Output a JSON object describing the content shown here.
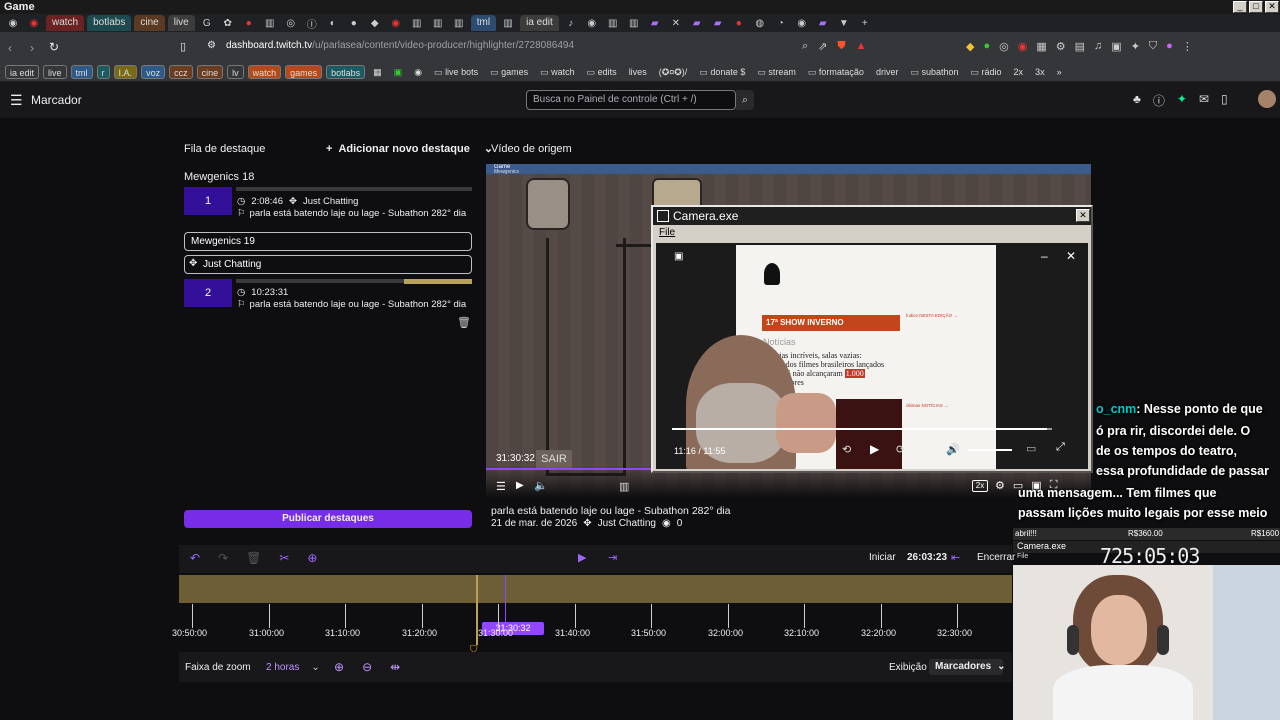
{
  "window": {
    "title": "Game"
  },
  "browser": {
    "tabs": [
      "watch",
      "botlabs",
      "cine",
      "live",
      "tml",
      "ia edit"
    ],
    "url": "dashboard.twitch.tv/u/parlasea/content/video-producer/highlighter/2728086494",
    "url_host": "dashboard.twitch.tv",
    "url_path": "/u/parlasea/content/video-producer/highlighter/2728086494",
    "bookmarks": [
      "ia edit",
      "live",
      "tml",
      "r",
      "I.A.",
      "voz",
      "ccz",
      "cine",
      "lv",
      "watch",
      "games",
      "botlabs",
      "live bots",
      "games",
      "watch",
      "edits",
      "lives",
      "(✪¤✪)/",
      "donate $",
      "stream",
      "formatação",
      "driver",
      "subathon",
      "rádio",
      "2x",
      "3x"
    ]
  },
  "header": {
    "title": "Marcador",
    "search_placeholder": "Busca no Painel de controle (Ctrl + /)"
  },
  "queue": {
    "title": "Fila de destaque",
    "add_label": "Adicionar novo destaque",
    "groups": [
      {
        "name": "Mewgenics 18",
        "number": "1",
        "time": "2:08:46",
        "category": "Just Chatting",
        "title": "parla está batendo laje ou lage - Subathon 282° dia"
      },
      {
        "name": "Mewgenics 19",
        "number": "2",
        "category": "Just Chatting",
        "time": "10:23:31",
        "title": "parla está batendo laje ou lage - Subathon 282° dia"
      }
    ],
    "publish_label": "Publicar destaques"
  },
  "source": {
    "title": "Vídeo de origem",
    "timecode": "31:30:32",
    "speed": "2x",
    "video_title": "parla está batendo laje ou lage - Subathon 282° dia",
    "date": "21 de mar. de 2026",
    "category": "Just Chatting",
    "views": "0",
    "overlay_title": "Game",
    "overlay_sub": "Mewgenics"
  },
  "camera_window": {
    "title": "Camera.exe",
    "menu_file": "File",
    "player_time": "11:16 / 11:55",
    "article": {
      "banner": "17ª SHOW INVERNO",
      "section": "Notícias",
      "headline_a": "Vitórias incríveis, salas vazias:",
      "headline_b": "54,7% dos filmes brasileiros lançados",
      "headline_c": "em 2025 não alcançaram",
      "highlight": "1.000",
      "headline_d": "espectadores",
      "sidebar_title": "Índice NESTA EDIÇÃO →",
      "sidebar_title2": "últimas NOTÍCIAS →"
    }
  },
  "editor": {
    "start_label": "Iniciar",
    "start_time": "26:03:23",
    "end_label": "Encerrar",
    "playhead": "31:30:32",
    "ticks": [
      "30:50:00",
      "31:00:00",
      "31:10:00",
      "31:20:00",
      "31:30:00",
      "31:40:00",
      "31:50:00",
      "32:00:00",
      "32:10:00",
      "32:20:00",
      "32:30:00"
    ],
    "zoom_label": "Faixa de zoom",
    "zoom_value": "2 horas",
    "display_label": "Exibição",
    "display_value": "Marcadores"
  },
  "chat": {
    "user": "o_cnm",
    "lines": [
      ": Nesse ponto de que",
      "ó pra rir, discordei dele. O",
      "de os tempos do teatro,",
      "essa profundidade de passar",
      "uma mensagem... Tem filmes que",
      "passam lições muito legais por esse meio"
    ]
  },
  "webcam_overlay": {
    "label_a": "abril!!!",
    "amount_a": "R$360.00",
    "amount_b": "R$1600",
    "window_title": "Camera.exe",
    "menu": "File",
    "timer": "725:05:03"
  },
  "colors": {
    "purple": "#9147ff",
    "brand_dark": "#34109a",
    "gold": "#b8a15a"
  }
}
